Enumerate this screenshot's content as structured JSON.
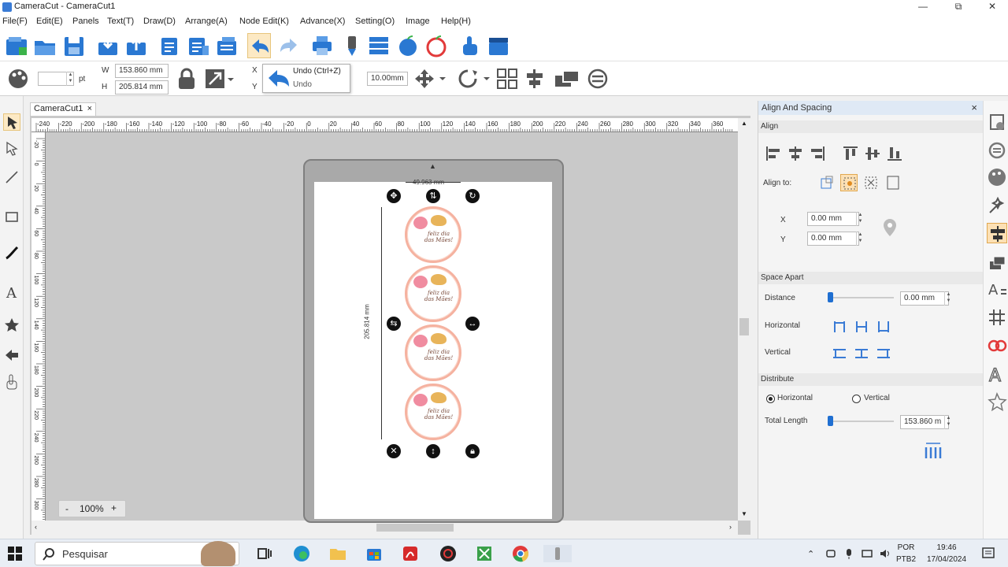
{
  "window": {
    "title": "CameraCut - CameraCut1",
    "minimize": "—",
    "maximize": "⧉",
    "close": "✕"
  },
  "menu": [
    "File(F)",
    "Edit(E)",
    "Panels",
    "Text(T)",
    "Draw(D)",
    "Arrange(A)",
    "Node Edit(K)",
    "Advance(X)",
    "Setting(O)",
    "Image",
    "Help(H)"
  ],
  "props": {
    "pt_label": "pt",
    "w_label": "W",
    "w_value": "153.860 mm",
    "h_label": "H",
    "h_value": "205.814 mm",
    "x_label": "X",
    "y_label": "Y",
    "offset_value": "10.00mm"
  },
  "tooltip": {
    "title": "Undo (Ctrl+Z)",
    "subtitle": "Undo"
  },
  "doc_tab": {
    "label": "CameraCut1",
    "close": "×"
  },
  "ruler": {
    "top_labels": [
      "-240",
      "-220",
      "-200",
      "-180",
      "-160",
      "-140",
      "-120",
      "-100",
      "-80",
      "-60",
      "-40",
      "-20",
      "0",
      "20",
      "40",
      "60",
      "80",
      "100",
      "120",
      "140",
      "160",
      "180",
      "200",
      "220",
      "240",
      "260",
      "280",
      "300",
      "320",
      "340",
      "360"
    ],
    "left_labels": [
      "-20",
      "0",
      "20",
      "40",
      "60",
      "80",
      "100",
      "120",
      "140",
      "160",
      "180",
      "200",
      "220",
      "240",
      "260",
      "280",
      "300"
    ]
  },
  "canvas": {
    "width_dim": "49.963 mm",
    "height_dim": "205.814 mm",
    "circle_text": "feliz dia\ndas Mães!"
  },
  "zoom": {
    "minus": "-",
    "value": "100%",
    "plus": "+"
  },
  "panel": {
    "title": "Align And Spacing",
    "close": "×",
    "align_header": "Align",
    "align_to_label": "Align to:",
    "x_label": "X",
    "x_value": "0.00 mm",
    "y_label": "Y",
    "y_value": "0.00 mm",
    "space_apart_header": "Space Apart",
    "distance_label": "Distance",
    "distance_value": "0.00 mm",
    "horizontal_label": "Horizontal",
    "vertical_label": "Vertical",
    "distribute_header": "Distribute",
    "radio_horizontal": "Horizontal",
    "radio_vertical": "Vertical",
    "total_length_label": "Total Length",
    "total_length_value": "153.860 m",
    "distribute_mode": "Horizontal"
  },
  "taskbar": {
    "search_placeholder": "Pesquisar",
    "lang1": "POR",
    "lang2": "PTB2",
    "time": "19:46",
    "date": "17/04/2024"
  },
  "colors": {
    "accent": "#1f6fd1",
    "toolbar_blue": "#2a78d2",
    "selection_orange": "#f0a030",
    "red_icon": "#e23a3a"
  }
}
